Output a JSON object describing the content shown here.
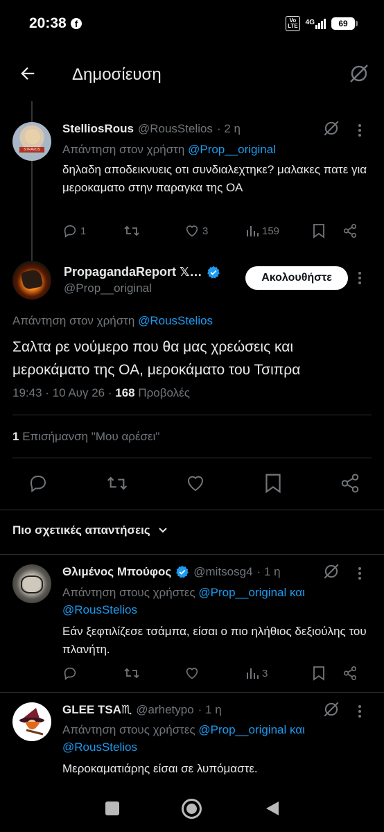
{
  "status": {
    "time": "20:38",
    "fb": "f",
    "volte_top": "Vo",
    "volte_bottom": "LTE",
    "network": "4G",
    "battery": "69"
  },
  "topbar": {
    "title": "Δημοσίευση"
  },
  "reply_tweet": {
    "name": "StelliosRous",
    "handle": "@RousStelios",
    "time": "· 2 η",
    "reply_prefix": "Απάντηση στον χρήστη",
    "reply_user": "@Prop__original",
    "text": "δηλαδη αποδεικνυεις οτι συνδιαλεχτηκε? μαλακες πατε για μεροκαματο στην παραγκα της ΟΑ",
    "counts": {
      "replies": "1",
      "retweets": "",
      "likes": "3",
      "views": "159"
    },
    "avatar_caption": "STRAVOS"
  },
  "main_tweet": {
    "name": "PropagandaReport 𝕏…",
    "handle": "@Prop__original",
    "follow_label": "Ακολουθήστε",
    "reply_prefix": "Απάντηση στον χρήστη",
    "reply_user": "@RousStelios",
    "text": "Σαλτα ρε νούμερο που θα μας χρεώσεις και μεροκάματο της ΟΑ, μεροκάματο του Τσιπρα",
    "time_date": "19:43 · 10 Αυγ 26 ·",
    "views_count": "168",
    "views_label": "Προβολές",
    "likes_count": "1",
    "likes_label": "Επισήμανση \"Μου αρέσει\""
  },
  "relevant_label": "Πιο σχετικές απαντήσεις",
  "replies": [
    {
      "name": "Θλιμένος Μπούφος",
      "handle": "@mitsosg4",
      "time": "· 1 η",
      "reply_prefix": "Απάντηση στους χρήστες",
      "reply_users_line1": "@Prop__original και",
      "reply_users_line2": "@RousStelios",
      "text": "Εάν ξεφτιλίζεσε τσάμπα, είσαι ο πιο ηλήθιος δεξιούλης του πλανήτη.",
      "counts": {
        "views": "3"
      }
    },
    {
      "name": "GLEE TSA♏",
      "handle": "@arhetypo",
      "time": "· 1 η",
      "reply_prefix": "Απάντηση στους χρήστες",
      "reply_users_line1": "@Prop__original και",
      "reply_users_line2": "@RousStelios",
      "text": "Μεροκαματιάρης είσαι σε λυπόμαστε."
    }
  ],
  "colors": {
    "background": "#000000",
    "accent": "#1d9bf0",
    "secondary_text": "#71767b",
    "primary_text": "#e7e9ea"
  }
}
